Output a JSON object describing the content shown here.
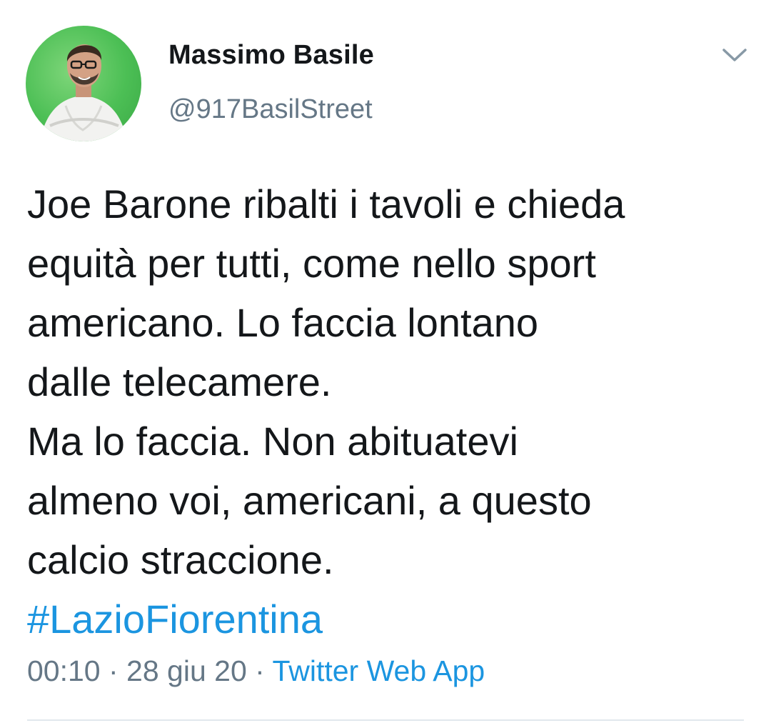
{
  "author": {
    "display_name": "Massimo Basile",
    "handle": "@917BasilStreet",
    "avatar_icon": "user-avatar-photo"
  },
  "menu": {
    "icon": "chevron-down-icon"
  },
  "tweet": {
    "lines": [
      "Joe Barone ribalti i tavoli e chieda",
      "equità per tutti, come nello sport",
      "americano. Lo faccia lontano",
      "dalle telecamere.",
      "Ma lo faccia. Non abituatevi",
      "almeno voi, americani, a questo",
      "calcio straccione."
    ],
    "hashtag": "#LazioFiorentina"
  },
  "meta": {
    "time": "00:10",
    "separator": " · ",
    "date": "28 giu 20",
    "source": "Twitter Web App"
  },
  "colors": {
    "link": "#1b95e0",
    "secondary_text": "#657786",
    "primary_text": "#14171a",
    "avatar_bg": "#4cbf55"
  }
}
